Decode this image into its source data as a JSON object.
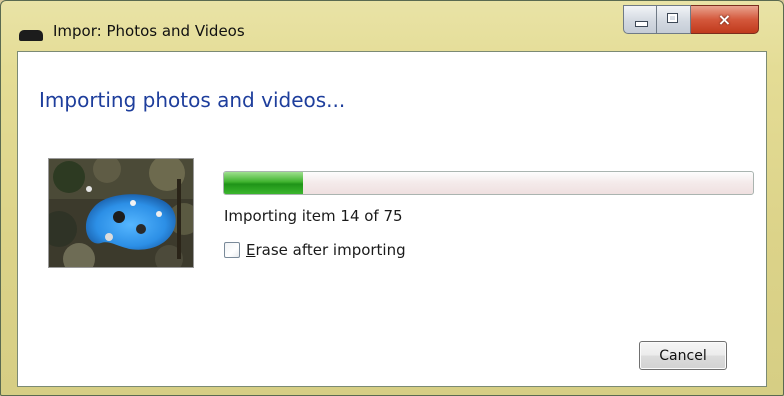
{
  "window": {
    "title": "Impor: Photos and Videos",
    "controls": {
      "minimize": "minimize",
      "maximize": "maximize",
      "close": "×"
    }
  },
  "dialog": {
    "heading": "Importing photos and videos...",
    "thumbnail_icon": "photo-thumbnail",
    "progress": {
      "fraction": 0.15,
      "color": "#2a9e1f"
    },
    "status_text": "Importing item 14 of 75",
    "erase_option": {
      "mnemonic": "E",
      "label_rest": "rase after importing",
      "checked": false
    },
    "cancel_label": "Cancel"
  }
}
